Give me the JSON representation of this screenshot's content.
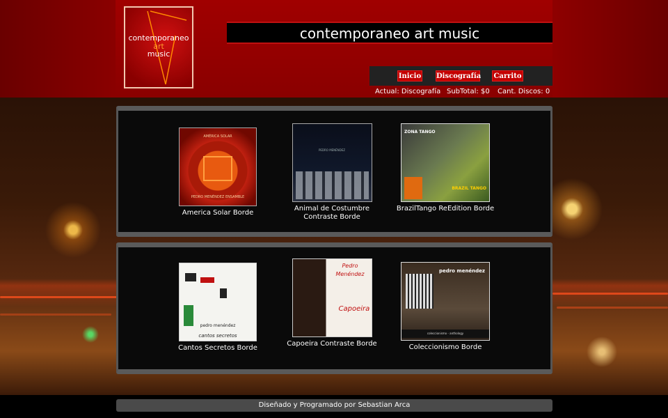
{
  "header": {
    "logo": {
      "line1": "contemporaneo",
      "line2": "art",
      "line3": "music"
    },
    "site_title": "contemporaneo art music"
  },
  "nav": {
    "items": [
      {
        "label": "Inicio"
      },
      {
        "label": "Discografía"
      },
      {
        "label": "Carrito"
      }
    ]
  },
  "status": {
    "actual_label": "Actual:",
    "actual_value": "Discografía",
    "subtotal_label": "SubTotal:",
    "subtotal_value": "$0",
    "count_label": "Cant. Discos:",
    "count_value": "0"
  },
  "albums": [
    {
      "title": "America Solar Borde",
      "cover_top": "AMÉRICA SOLAR",
      "cover_bottom": "PEDRO MENÉNDEZ ENSAMBLE"
    },
    {
      "title": "Animal de Costumbre Contraste Borde",
      "cover_top": "PEDRO MENÉNDEZ",
      "cover_bottom": ""
    },
    {
      "title": "BrazilTango ReEdition Borde",
      "cover_top": "ZONA TANGO",
      "cover_bottom": "BRAZIL TANGO"
    },
    {
      "title": "Cantos Secretos Borde",
      "cover_top": "pedro menéndez",
      "cover_bottom": "cantos secretos"
    },
    {
      "title": "Capoeira Contraste Borde",
      "cover_top": "Pedro Menéndez",
      "cover_bottom": "Capoeira"
    },
    {
      "title": "Coleccionismo Borde",
      "cover_top": "pedro menéndez",
      "cover_bottom": "coleccionismo - anthology"
    }
  ],
  "footer": {
    "text": "Diseñado y Programado por Sebastian Arca"
  }
}
